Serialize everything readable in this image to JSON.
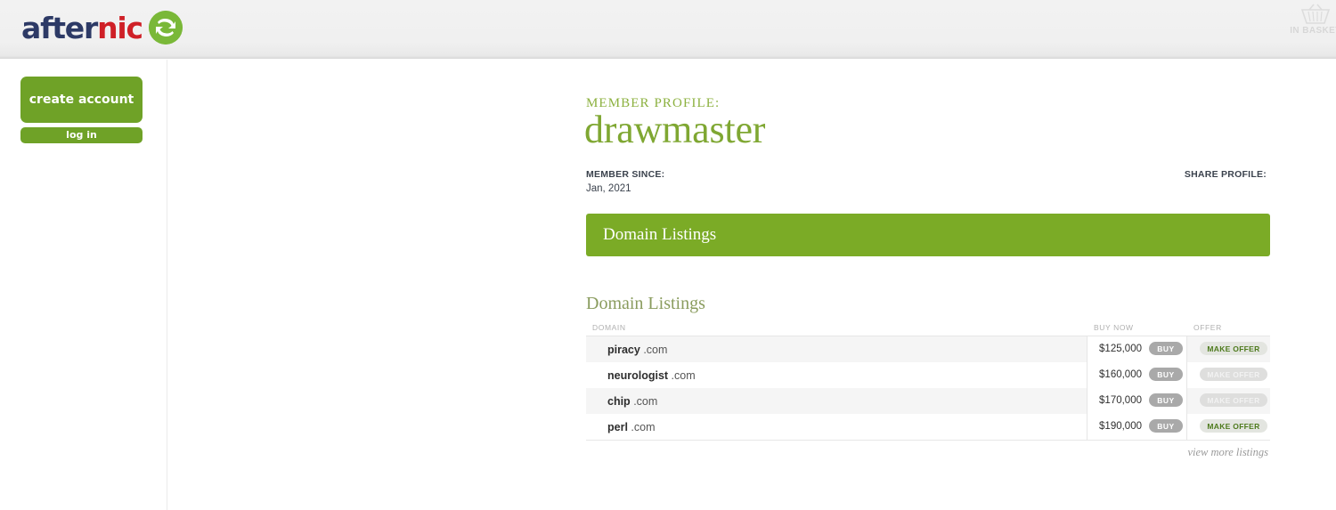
{
  "header": {
    "logo": {
      "text_dark": "after",
      "text_red": "nic",
      "mark_icon": "afternic-swoosh-icon",
      "color_dark": "#2d3a66",
      "color_red": "#cf2027",
      "color_mark": "#7ab838"
    },
    "basket": {
      "icon": "shopping-basket-icon",
      "label": "IN BASKET"
    }
  },
  "sidebar": {
    "create_account_label": "create account",
    "log_in_label": "log in",
    "button_color": "#6fa227"
  },
  "profile": {
    "kicker": "MEMBER PROFILE:",
    "name": "drawmaster",
    "member_since_label": "MEMBER SINCE:",
    "member_since_value": "Jan, 2021",
    "share_profile_label": "SHARE PROFILE:",
    "accent_color": "#7fa732"
  },
  "banner": {
    "title": "Domain Listings",
    "background_color": "#7bab26"
  },
  "listings": {
    "section_title": "Domain Listings",
    "columns": [
      "DOMAIN",
      "BUY NOW",
      "OFFER"
    ],
    "rows": [
      {
        "sld": "piracy",
        "tld": ".com",
        "price": "$125,000",
        "buy_label": "BUY",
        "offer_label": "MAKE OFFER",
        "offer_muted": false
      },
      {
        "sld": "neurologist",
        "tld": ".com",
        "price": "$160,000",
        "buy_label": "BUY",
        "offer_label": "MAKE OFFER",
        "offer_muted": true
      },
      {
        "sld": "chip",
        "tld": ".com",
        "price": "$170,000",
        "buy_label": "BUY",
        "offer_label": "MAKE OFFER",
        "offer_muted": true
      },
      {
        "sld": "perl",
        "tld": ".com",
        "price": "$190,000",
        "buy_label": "BUY",
        "offer_label": "MAKE OFFER",
        "offer_muted": false
      }
    ],
    "view_more_label": "view more listings"
  }
}
